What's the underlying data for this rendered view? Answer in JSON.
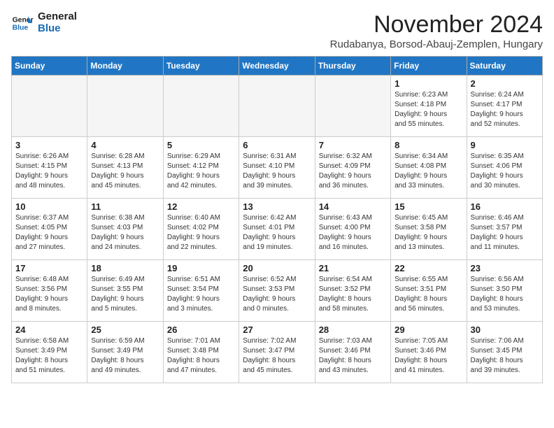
{
  "logo": {
    "line1": "General",
    "line2": "Blue"
  },
  "title": "November 2024",
  "subtitle": "Rudabanya, Borsod-Abauj-Zemplen, Hungary",
  "days_of_week": [
    "Sunday",
    "Monday",
    "Tuesday",
    "Wednesday",
    "Thursday",
    "Friday",
    "Saturday"
  ],
  "weeks": [
    [
      {
        "day": "",
        "info": ""
      },
      {
        "day": "",
        "info": ""
      },
      {
        "day": "",
        "info": ""
      },
      {
        "day": "",
        "info": ""
      },
      {
        "day": "",
        "info": ""
      },
      {
        "day": "1",
        "info": "Sunrise: 6:23 AM\nSunset: 4:18 PM\nDaylight: 9 hours\nand 55 minutes."
      },
      {
        "day": "2",
        "info": "Sunrise: 6:24 AM\nSunset: 4:17 PM\nDaylight: 9 hours\nand 52 minutes."
      }
    ],
    [
      {
        "day": "3",
        "info": "Sunrise: 6:26 AM\nSunset: 4:15 PM\nDaylight: 9 hours\nand 48 minutes."
      },
      {
        "day": "4",
        "info": "Sunrise: 6:28 AM\nSunset: 4:13 PM\nDaylight: 9 hours\nand 45 minutes."
      },
      {
        "day": "5",
        "info": "Sunrise: 6:29 AM\nSunset: 4:12 PM\nDaylight: 9 hours\nand 42 minutes."
      },
      {
        "day": "6",
        "info": "Sunrise: 6:31 AM\nSunset: 4:10 PM\nDaylight: 9 hours\nand 39 minutes."
      },
      {
        "day": "7",
        "info": "Sunrise: 6:32 AM\nSunset: 4:09 PM\nDaylight: 9 hours\nand 36 minutes."
      },
      {
        "day": "8",
        "info": "Sunrise: 6:34 AM\nSunset: 4:08 PM\nDaylight: 9 hours\nand 33 minutes."
      },
      {
        "day": "9",
        "info": "Sunrise: 6:35 AM\nSunset: 4:06 PM\nDaylight: 9 hours\nand 30 minutes."
      }
    ],
    [
      {
        "day": "10",
        "info": "Sunrise: 6:37 AM\nSunset: 4:05 PM\nDaylight: 9 hours\nand 27 minutes."
      },
      {
        "day": "11",
        "info": "Sunrise: 6:38 AM\nSunset: 4:03 PM\nDaylight: 9 hours\nand 24 minutes."
      },
      {
        "day": "12",
        "info": "Sunrise: 6:40 AM\nSunset: 4:02 PM\nDaylight: 9 hours\nand 22 minutes."
      },
      {
        "day": "13",
        "info": "Sunrise: 6:42 AM\nSunset: 4:01 PM\nDaylight: 9 hours\nand 19 minutes."
      },
      {
        "day": "14",
        "info": "Sunrise: 6:43 AM\nSunset: 4:00 PM\nDaylight: 9 hours\nand 16 minutes."
      },
      {
        "day": "15",
        "info": "Sunrise: 6:45 AM\nSunset: 3:58 PM\nDaylight: 9 hours\nand 13 minutes."
      },
      {
        "day": "16",
        "info": "Sunrise: 6:46 AM\nSunset: 3:57 PM\nDaylight: 9 hours\nand 11 minutes."
      }
    ],
    [
      {
        "day": "17",
        "info": "Sunrise: 6:48 AM\nSunset: 3:56 PM\nDaylight: 9 hours\nand 8 minutes."
      },
      {
        "day": "18",
        "info": "Sunrise: 6:49 AM\nSunset: 3:55 PM\nDaylight: 9 hours\nand 5 minutes."
      },
      {
        "day": "19",
        "info": "Sunrise: 6:51 AM\nSunset: 3:54 PM\nDaylight: 9 hours\nand 3 minutes."
      },
      {
        "day": "20",
        "info": "Sunrise: 6:52 AM\nSunset: 3:53 PM\nDaylight: 9 hours\nand 0 minutes."
      },
      {
        "day": "21",
        "info": "Sunrise: 6:54 AM\nSunset: 3:52 PM\nDaylight: 8 hours\nand 58 minutes."
      },
      {
        "day": "22",
        "info": "Sunrise: 6:55 AM\nSunset: 3:51 PM\nDaylight: 8 hours\nand 56 minutes."
      },
      {
        "day": "23",
        "info": "Sunrise: 6:56 AM\nSunset: 3:50 PM\nDaylight: 8 hours\nand 53 minutes."
      }
    ],
    [
      {
        "day": "24",
        "info": "Sunrise: 6:58 AM\nSunset: 3:49 PM\nDaylight: 8 hours\nand 51 minutes."
      },
      {
        "day": "25",
        "info": "Sunrise: 6:59 AM\nSunset: 3:49 PM\nDaylight: 8 hours\nand 49 minutes."
      },
      {
        "day": "26",
        "info": "Sunrise: 7:01 AM\nSunset: 3:48 PM\nDaylight: 8 hours\nand 47 minutes."
      },
      {
        "day": "27",
        "info": "Sunrise: 7:02 AM\nSunset: 3:47 PM\nDaylight: 8 hours\nand 45 minutes."
      },
      {
        "day": "28",
        "info": "Sunrise: 7:03 AM\nSunset: 3:46 PM\nDaylight: 8 hours\nand 43 minutes."
      },
      {
        "day": "29",
        "info": "Sunrise: 7:05 AM\nSunset: 3:46 PM\nDaylight: 8 hours\nand 41 minutes."
      },
      {
        "day": "30",
        "info": "Sunrise: 7:06 AM\nSunset: 3:45 PM\nDaylight: 8 hours\nand 39 minutes."
      }
    ]
  ]
}
